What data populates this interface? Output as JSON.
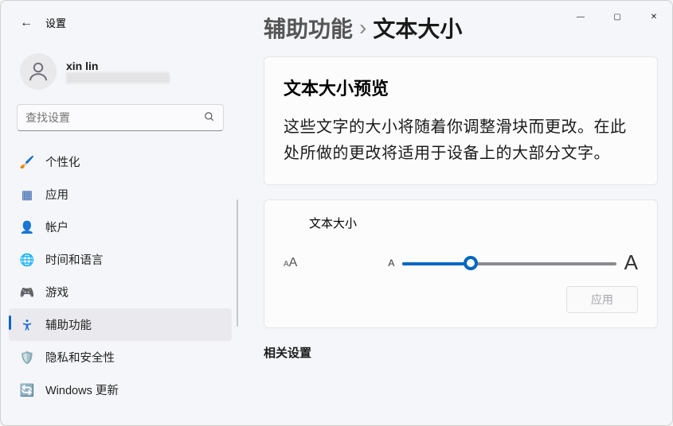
{
  "header": {
    "settings_label": "设置"
  },
  "window_controls": {
    "min": "—",
    "max": "▢",
    "close": "✕"
  },
  "breadcrumb": {
    "parent": "辅助功能",
    "sep": "›",
    "current": "文本大小"
  },
  "user": {
    "name": "xin lin"
  },
  "search": {
    "placeholder": "查找设置",
    "icon_glyph": "⌕"
  },
  "nav": {
    "items": [
      {
        "label": "个性化",
        "icon": "🖌️",
        "selected": false
      },
      {
        "label": "应用",
        "icon": "▦",
        "selected": false
      },
      {
        "label": "帐户",
        "icon": "👤",
        "selected": false
      },
      {
        "label": "时间和语言",
        "icon": "🌐",
        "selected": false
      },
      {
        "label": "游戏",
        "icon": "🎮",
        "selected": false
      },
      {
        "label": "辅助功能",
        "icon": "✖",
        "selected": true
      },
      {
        "label": "隐私和安全性",
        "icon": "🛡️",
        "selected": false
      },
      {
        "label": "Windows 更新",
        "icon": "🔄",
        "selected": false
      }
    ]
  },
  "main": {
    "preview_title": "文本大小预览",
    "preview_body": "这些文字的大小将随着你调整滑块而更改。在此处所做的更改将适用于设备上的大部分文字。",
    "slider_label": "文本大小",
    "a_small": "A",
    "a_large": "A",
    "apply_label": "应用",
    "related_heading": "相关设置"
  }
}
